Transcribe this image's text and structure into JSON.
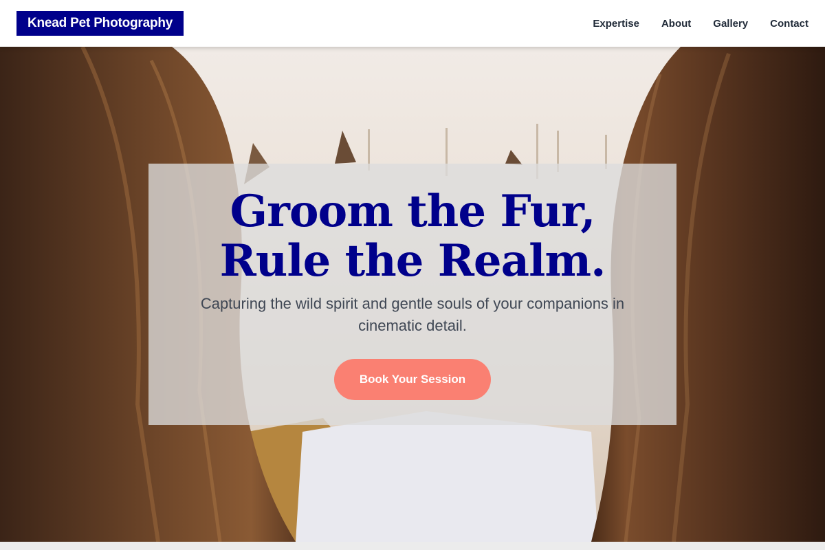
{
  "header": {
    "logo": "Knead Pet Photography",
    "nav": [
      {
        "label": "Expertise"
      },
      {
        "label": "About"
      },
      {
        "label": "Gallery"
      },
      {
        "label": "Contact"
      }
    ]
  },
  "hero": {
    "title": "Groom the Fur, Rule the Realm.",
    "subtitle": "Capturing the wild spirit and gentle souls of your companions in cinematic detail.",
    "cta_label": "Book Your Session"
  },
  "colors": {
    "brand": "#00008b",
    "cta": "#fa8072",
    "header_bg": "#ffffff",
    "card_overlay": "rgba(220,220,220,0.78)"
  }
}
